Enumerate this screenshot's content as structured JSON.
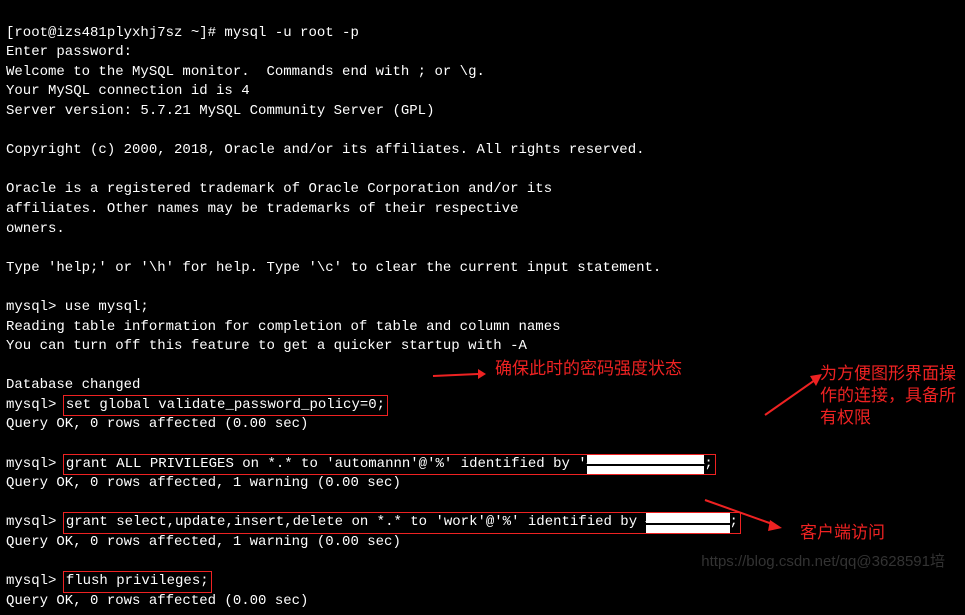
{
  "terminal": {
    "lines": [
      "[root@izs481plyxhj7sz ~]# mysql -u root -p",
      "Enter password:",
      "Welcome to the MySQL monitor.  Commands end with ; or \\g.",
      "Your MySQL connection id is 4",
      "Server version: 5.7.21 MySQL Community Server (GPL)",
      "",
      "Copyright (c) 2000, 2018, Oracle and/or its affiliates. All rights reserved.",
      "",
      "Oracle is a registered trademark of Oracle Corporation and/or its",
      "affiliates. Other names may be trademarks of their respective",
      "owners.",
      "",
      "Type 'help;' or '\\h' for help. Type '\\c' to clear the current input statement.",
      "",
      "mysql> use mysql;",
      "Reading table information for completion of table and column names",
      "You can turn off this feature to get a quicker startup with -A",
      "",
      "Database changed"
    ],
    "cmd1_prompt": "mysql> ",
    "cmd1": "set global validate_password_policy=0;",
    "result1": "Query OK, 0 rows affected (0.00 sec)",
    "cmd2_prompt": "mysql> ",
    "cmd2_part1": "grant ALL PRIVILEGES on *.* to 'automannn'@'%' identified by '",
    "cmd2_redacted": "              ",
    "cmd2_part2": ";",
    "result2": "Query OK, 0 rows affected, 1 warning (0.00 sec)",
    "cmd3_prompt": "mysql> ",
    "cmd3_part1": "grant select,update,insert,delete on *.* to 'work'@'%' identified by ",
    "cmd3_redacted": "          ",
    "cmd3_part2": ";",
    "result3": "Query OK, 0 rows affected, 1 warning (0.00 sec)",
    "cmd4_prompt": "mysql> ",
    "cmd4": "flush privileges;",
    "result4": "Query OK, 0 rows affected (0.00 sec)"
  },
  "annotations": {
    "a1": "确保此时的密码强度状态",
    "a2": "为方便图形界面操作的连接，具备所有权限",
    "a3": "客户端访问"
  },
  "watermark": "https://blog.csdn.net/qq@3628591培"
}
